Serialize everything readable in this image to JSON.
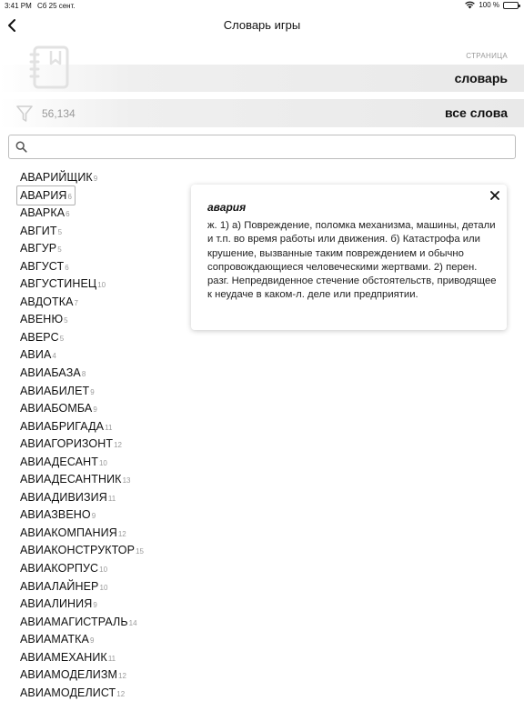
{
  "status_bar": {
    "time": "3:41 PM",
    "date": "Сб 25 сент.",
    "battery": "100 %"
  },
  "nav": {
    "title": "Словарь игры"
  },
  "page": {
    "label": "СТРАНИЦА",
    "value": "словарь"
  },
  "filter": {
    "count": "56,134",
    "value": "все слова"
  },
  "search": {
    "value": "",
    "placeholder": ""
  },
  "words": [
    {
      "word": "АВАРИЙЩИК",
      "len": "9"
    },
    {
      "word": "АВАРИЯ",
      "len": "6"
    },
    {
      "word": "АВАРКА",
      "len": "6"
    },
    {
      "word": "АВГИТ",
      "len": "5"
    },
    {
      "word": "АВГУР",
      "len": "5"
    },
    {
      "word": "АВГУСТ",
      "len": "6"
    },
    {
      "word": "АВГУСТИНЕЦ",
      "len": "10"
    },
    {
      "word": "АВДОТКА",
      "len": "7"
    },
    {
      "word": "АВЕНЮ",
      "len": "5"
    },
    {
      "word": "АВЕРС",
      "len": "5"
    },
    {
      "word": "АВИА",
      "len": "4"
    },
    {
      "word": "АВИАБАЗА",
      "len": "8"
    },
    {
      "word": "АВИАБИЛЕТ",
      "len": "9"
    },
    {
      "word": "АВИАБОМБА",
      "len": "9"
    },
    {
      "word": "АВИАБРИГАДА",
      "len": "11"
    },
    {
      "word": "АВИАГОРИЗОНТ",
      "len": "12"
    },
    {
      "word": "АВИАДЕСАНТ",
      "len": "10"
    },
    {
      "word": "АВИАДЕСАНТНИК",
      "len": "13"
    },
    {
      "word": "АВИАДИВИЗИЯ",
      "len": "11"
    },
    {
      "word": "АВИАЗВЕНО",
      "len": "9"
    },
    {
      "word": "АВИАКОМПАНИЯ",
      "len": "12"
    },
    {
      "word": "АВИАКОНСТРУКТОР",
      "len": "15"
    },
    {
      "word": "АВИАКОРПУС",
      "len": "10"
    },
    {
      "word": "АВИАЛАЙНЕР",
      "len": "10"
    },
    {
      "word": "АВИАЛИНИЯ",
      "len": "9"
    },
    {
      "word": "АВИАМАГИСТРАЛЬ",
      "len": "14"
    },
    {
      "word": "АВИАМАТКА",
      "len": "9"
    },
    {
      "word": "АВИАМЕХАНИК",
      "len": "11"
    },
    {
      "word": "АВИАМОДЕЛИЗМ",
      "len": "12"
    },
    {
      "word": "АВИАМОДЕЛИСТ",
      "len": "12"
    }
  ],
  "definition": {
    "word": "авария",
    "text": "ж. 1) а) Повреждение, поломка механизма, машины, детали и т.п. во время работы или движения. б) Катастрофа или крушение, вызванные таким повреждением и обычно сопровождающиеся человеческими жертвами. 2) перен. разг. Непредвиденное стечение обстоятельств, приводящее к неудаче в каком-л. деле или предприятии."
  }
}
